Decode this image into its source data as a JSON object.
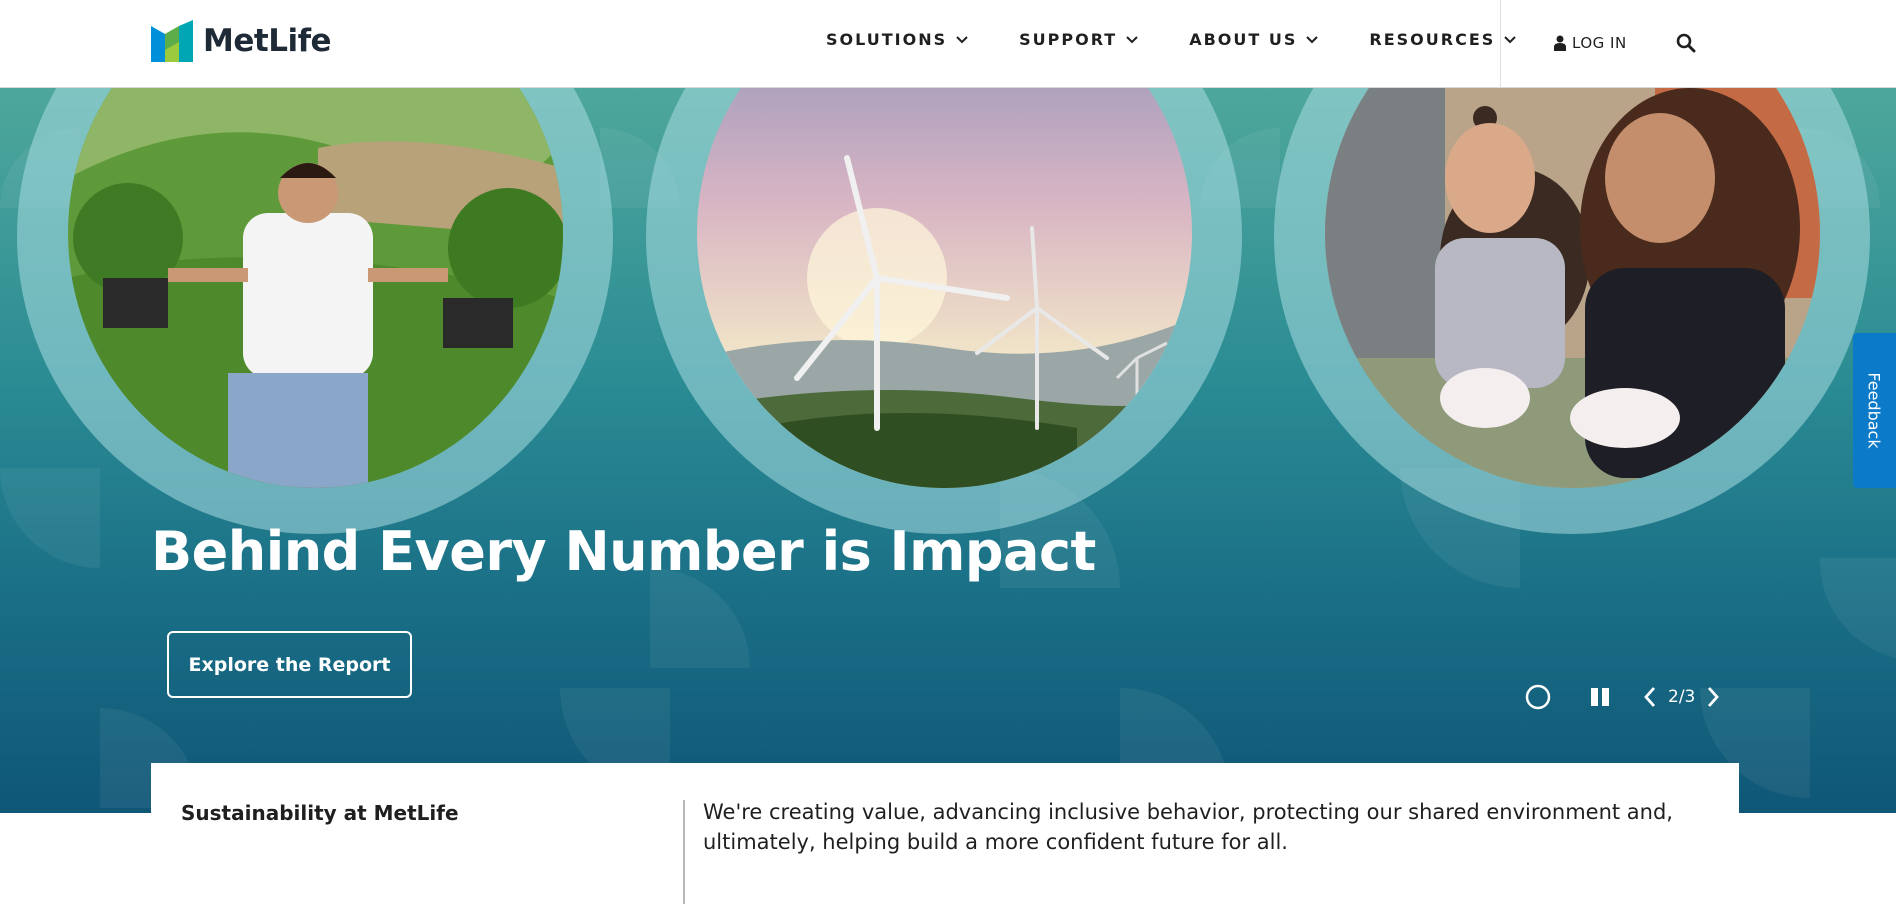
{
  "brand": {
    "name": "MetLife",
    "colors": {
      "green": "#9bcb3c",
      "blue": "#0090da",
      "teal": "#00a6b4"
    }
  },
  "nav": {
    "items": [
      {
        "label": "SOLUTIONS",
        "icon": "chevron-down-icon"
      },
      {
        "label": "SUPPORT",
        "icon": "chevron-down-icon"
      },
      {
        "label": "ABOUT US",
        "icon": "chevron-down-icon"
      },
      {
        "label": "RESOURCES",
        "icon": "chevron-down-icon"
      }
    ],
    "login_label": "LOG IN",
    "login_icon": "user-icon",
    "search_icon": "search-icon"
  },
  "hero": {
    "title": "Behind Every Number is Impact",
    "cta_label": "Explore the Report",
    "slide_counter": "2/3",
    "photos": [
      {
        "icon": "man-holding-seedlings-photo"
      },
      {
        "icon": "wind-turbines-photo"
      },
      {
        "icon": "mother-and-daughter-photo"
      }
    ],
    "controls": {
      "indicator_icon": "circle-icon",
      "pause_icon": "pause-icon",
      "prev_icon": "chevron-left-icon",
      "next_icon": "chevron-right-icon"
    }
  },
  "feedback": {
    "label": "Feedback"
  },
  "info_card": {
    "label": "Sustainability at MetLife",
    "text": "We're creating value, advancing inclusive behavior, protecting our shared environment and, ultimately, helping build a more confident future for all."
  }
}
